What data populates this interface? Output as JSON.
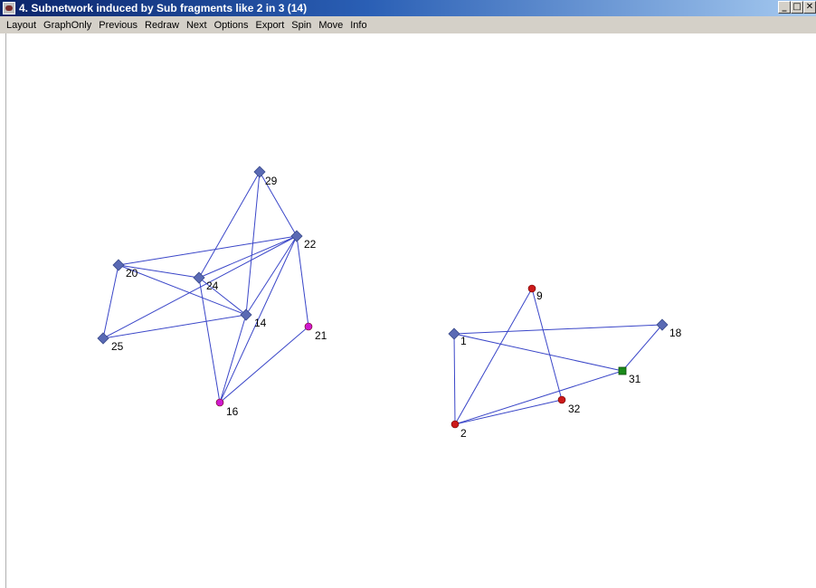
{
  "window": {
    "title": "4. Subnetwork induced by Sub fragments like  2 in 3 (14)",
    "buttons": [
      "_",
      "□",
      "✕"
    ]
  },
  "menu": [
    "Layout",
    "GraphOnly",
    "Previous",
    "Redraw",
    "Next",
    "Options",
    "Export",
    "Spin",
    "Move",
    "Info"
  ],
  "colors": {
    "edge": "#3a46c8",
    "diamond": "#5a6ab4",
    "red": "#cc1a1a",
    "magenta": "#d01ad0",
    "green": "#1a8a1a",
    "title_bar": "#0a246a",
    "menu_bg": "#d4d0c8"
  },
  "graph": {
    "nodes": [
      {
        "id": "29",
        "shape": "diamond",
        "color": "diamond"
      },
      {
        "id": "22",
        "shape": "diamond",
        "color": "diamond"
      },
      {
        "id": "20",
        "shape": "diamond",
        "color": "diamond"
      },
      {
        "id": "24",
        "shape": "diamond",
        "color": "diamond"
      },
      {
        "id": "14",
        "shape": "diamond",
        "color": "diamond"
      },
      {
        "id": "25",
        "shape": "diamond",
        "color": "diamond"
      },
      {
        "id": "21",
        "shape": "circle",
        "color": "magenta"
      },
      {
        "id": "16",
        "shape": "circle",
        "color": "magenta"
      },
      {
        "id": "9",
        "shape": "circle",
        "color": "red"
      },
      {
        "id": "1",
        "shape": "diamond",
        "color": "diamond"
      },
      {
        "id": "18",
        "shape": "diamond",
        "color": "diamond"
      },
      {
        "id": "31",
        "shape": "square",
        "color": "green"
      },
      {
        "id": "32",
        "shape": "circle",
        "color": "red"
      },
      {
        "id": "2",
        "shape": "circle",
        "color": "red"
      }
    ],
    "edges": [
      [
        "29",
        "22"
      ],
      [
        "29",
        "24"
      ],
      [
        "29",
        "14"
      ],
      [
        "22",
        "20"
      ],
      [
        "22",
        "24"
      ],
      [
        "22",
        "14"
      ],
      [
        "22",
        "16"
      ],
      [
        "22",
        "21"
      ],
      [
        "22",
        "25"
      ],
      [
        "20",
        "24"
      ],
      [
        "20",
        "14"
      ],
      [
        "20",
        "25"
      ],
      [
        "24",
        "14"
      ],
      [
        "24",
        "16"
      ],
      [
        "14",
        "25"
      ],
      [
        "14",
        "16"
      ],
      [
        "21",
        "16"
      ],
      [
        "1",
        "18"
      ],
      [
        "1",
        "31"
      ],
      [
        "1",
        "2"
      ],
      [
        "9",
        "2"
      ],
      [
        "9",
        "32"
      ],
      [
        "18",
        "31"
      ],
      [
        "31",
        "2"
      ],
      [
        "32",
        "2"
      ]
    ]
  }
}
